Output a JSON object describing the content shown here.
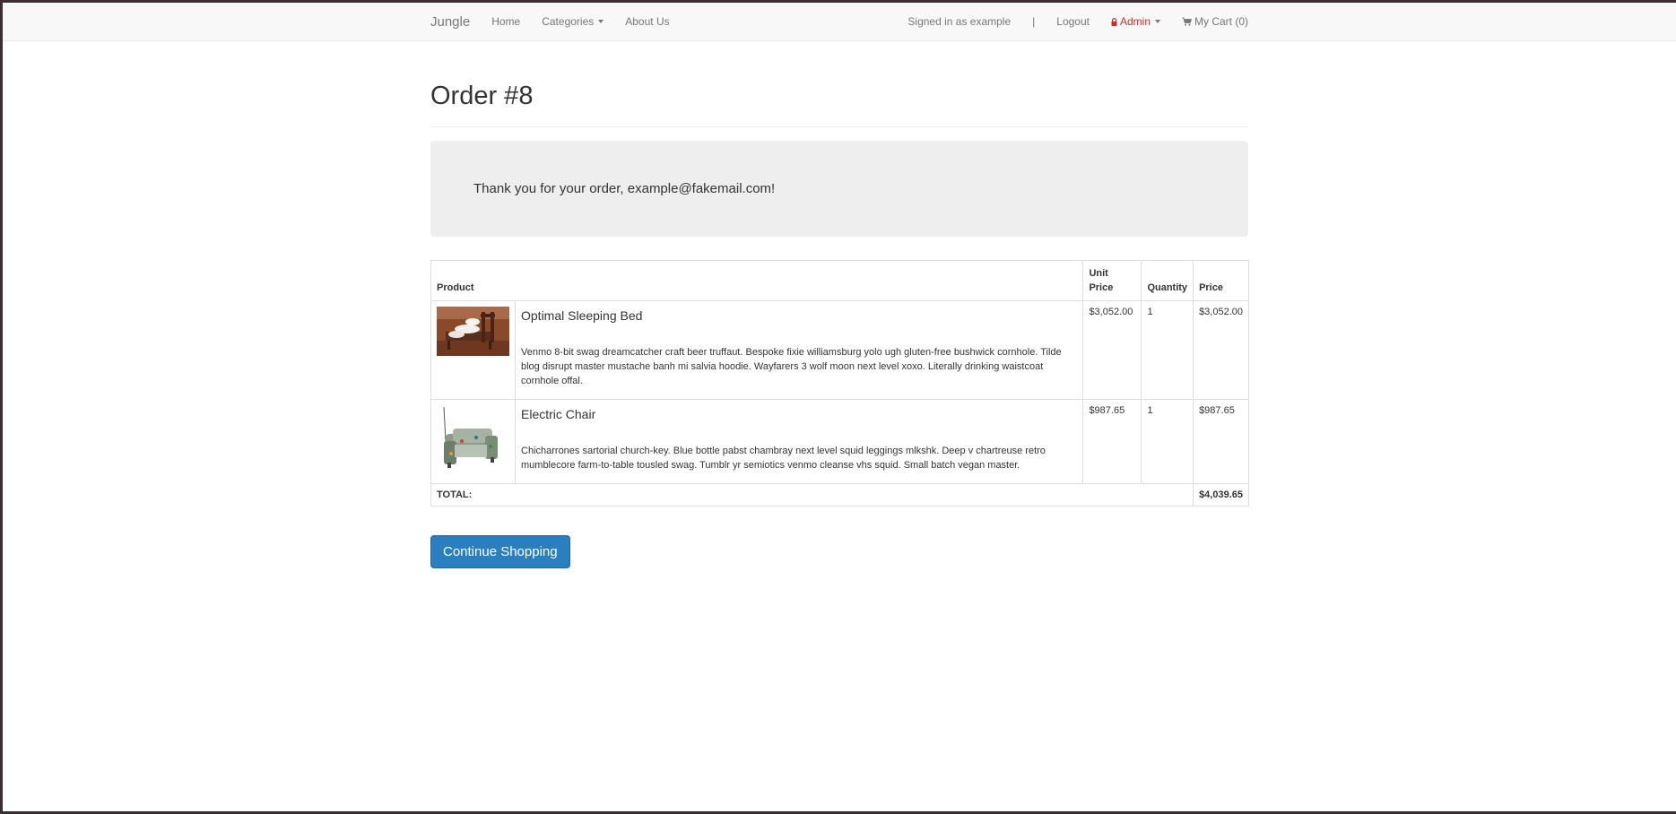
{
  "nav": {
    "brand": "Jungle",
    "home": "Home",
    "categories": "Categories",
    "about": "About Us",
    "signed_in": "Signed in as example",
    "separator": "|",
    "logout": "Logout",
    "admin": "Admin",
    "cart": "My Cart (0)"
  },
  "page": {
    "title": "Order #8",
    "thanks": "Thank you for your order, example@fakemail.com!"
  },
  "table": {
    "headers": {
      "product": "Product",
      "unit_price_line1": "Unit",
      "unit_price_line2": "Price",
      "quantity": "Quantity",
      "price": "Price"
    },
    "items": [
      {
        "name": "Optimal Sleeping Bed",
        "description": "Venmo 8-bit swag dreamcatcher craft beer truffaut. Bespoke fixie williamsburg yolo ugh gluten-free bushwick cornhole. Tilde blog disrupt master mustache banh mi salvia hoodie. Wayfarers 3 wolf moon next level xoxo. Literally drinking waistcoat cornhole offal.",
        "unit_price": "$3,052.00",
        "quantity": "1",
        "price": "$3,052.00"
      },
      {
        "name": "Electric Chair",
        "description": "Chicharrones sartorial church-key. Blue bottle pabst chambray next level squid leggings mlkshk. Deep v chartreuse retro mumblecore farm-to-table tousled swag. Tumblr yr semiotics venmo cleanse vhs squid. Small batch vegan master.",
        "unit_price": "$987.65",
        "quantity": "1",
        "price": "$987.65"
      }
    ],
    "total_label": "TOTAL:",
    "total_value": "$4,039.65"
  },
  "actions": {
    "continue_shopping": "Continue Shopping"
  },
  "colors": {
    "primary_button": "#2a7fc0",
    "admin_link": "#c9302c",
    "jumbotron": "#eeeeee"
  }
}
